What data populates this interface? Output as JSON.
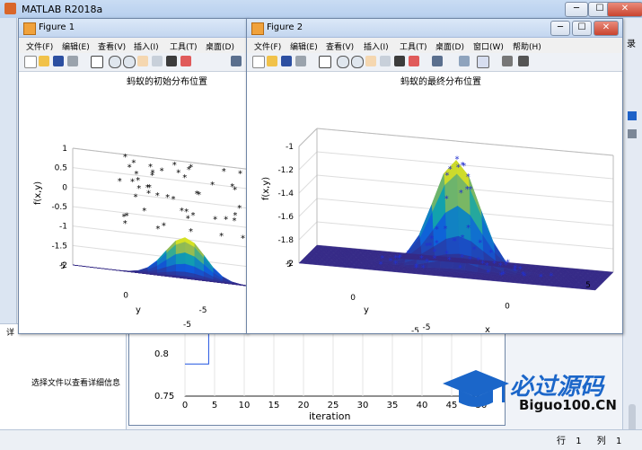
{
  "app": {
    "title": "MATLAB R2018a",
    "record_label": "录",
    "close": "✕",
    "minimize": "─",
    "maximize": "☐"
  },
  "detail": {
    "text": "选择文件以查看详细信息",
    "panel_tab": "详"
  },
  "status": {
    "row_label": "行",
    "row_value": "1",
    "col_label": "列",
    "col_value": "1"
  },
  "figures": [
    {
      "title": "Figure 1",
      "plot_title": "蚂蚁的初始分布位置",
      "menus": [
        "文件(F)",
        "编辑(E)",
        "查看(V)",
        "插入(I)",
        "工具(T)",
        "桌面(D)"
      ],
      "zlabel": "f(x,y)",
      "ylabel": "y",
      "zticks": [
        "1",
        "0.5",
        "0",
        "-0.5",
        "-1",
        "-1.5",
        "-2"
      ],
      "yticks": [
        "5",
        "0",
        "-5"
      ],
      "xticks": [
        "-5"
      ]
    },
    {
      "title": "Figure 2",
      "plot_title": "蚂蚁的最终分布位置",
      "menus": [
        "文件(F)",
        "编辑(E)",
        "查看(V)",
        "插入(I)",
        "工具(T)",
        "桌面(D)",
        "窗口(W)",
        "帮助(H)"
      ],
      "zlabel": "f(x,y)",
      "ylabel": "y",
      "xlabel": "x",
      "zticks": [
        "-1",
        "-1.2",
        "-1.4",
        "-1.6",
        "-1.8",
        "-2"
      ],
      "yticks": [
        "5",
        "0",
        "-5"
      ],
      "xticks": [
        "-5",
        "0",
        "5"
      ]
    }
  ],
  "background_figure": {
    "xlabel": "iteration",
    "yticks": [
      "0.8",
      "0.75"
    ],
    "xticks": [
      "0",
      "5",
      "10",
      "15",
      "20",
      "25",
      "30",
      "35",
      "40",
      "45",
      "50"
    ]
  },
  "chart_data": [
    {
      "type": "surface",
      "title": "蚂蚁的初始分布位置",
      "zlabel": "f(x,y)",
      "ylabel": "y",
      "zlim": [
        -2,
        1
      ],
      "ylim": [
        -5,
        5
      ],
      "xlim": [
        -5,
        5
      ],
      "colormap": "parula",
      "markers": "black stars"
    },
    {
      "type": "surface",
      "title": "蚂蚁的最终分布位置",
      "zlabel": "f(x,y)",
      "ylabel": "y",
      "xlabel": "x",
      "zlim": [
        -2,
        -1
      ],
      "ylim": [
        -5,
        5
      ],
      "xlim": [
        -5,
        5
      ],
      "colormap": "parula",
      "markers": "blue stars"
    },
    {
      "type": "line",
      "xlabel": "iteration",
      "ylim": [
        0.75,
        0.82
      ],
      "xlim": [
        0,
        50
      ],
      "series": [
        {
          "values_x": [
            0,
            4,
            4,
            50
          ],
          "values_y": [
            0.775,
            0.775,
            0.82,
            0.82
          ]
        }
      ]
    }
  ],
  "watermark": {
    "text": "必过源码",
    "sub": "Biguo100.CN"
  }
}
